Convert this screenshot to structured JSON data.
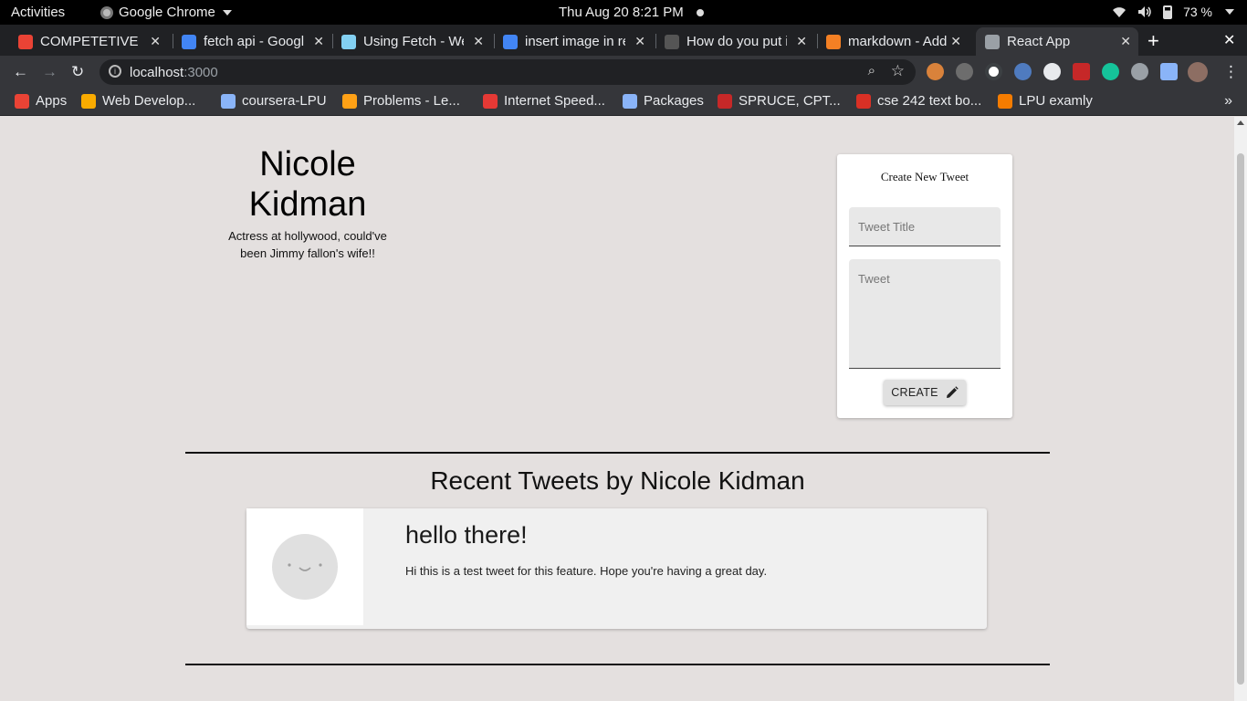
{
  "system_bar": {
    "activities": "Activities",
    "app_name": "Google Chrome",
    "datetime": "Thu Aug 20   8:21 PM",
    "battery": "73 %"
  },
  "tabs": [
    {
      "title": "COMPETETIVE E",
      "icon": "gmail-icon",
      "color": "#ea4335",
      "active": false
    },
    {
      "title": "fetch api - Googl",
      "icon": "google-icon",
      "color": "#4285f4",
      "active": false
    },
    {
      "title": "Using Fetch - We",
      "icon": "mdn-icon",
      "color": "#83d0f2",
      "active": false
    },
    {
      "title": "insert image in re",
      "icon": "google-icon",
      "color": "#4285f4",
      "active": false
    },
    {
      "title": "How do you put i",
      "icon": "github-icon",
      "color": "#555555",
      "active": false
    },
    {
      "title": "markdown - Add",
      "icon": "stackoverflow-icon",
      "color": "#f48024",
      "active": false
    },
    {
      "title": "React App",
      "icon": "globe-icon",
      "color": "#9aa0a6",
      "active": true
    }
  ],
  "omnibox": {
    "host": "localhost",
    "port": ":3000"
  },
  "bookmarks": [
    {
      "label": "Apps",
      "icon": "apps-grid-icon",
      "color": "#ea4335"
    },
    {
      "label": "Web Develop...",
      "icon": "bookmark-favicon-icon",
      "color": "#f9ab00"
    },
    {
      "label": "coursera-LPU",
      "icon": "coursera-icon",
      "color": "#8ab4f8"
    },
    {
      "label": "Problems - Le...",
      "icon": "leetcode-icon",
      "color": "#ffa116"
    },
    {
      "label": "Internet Speed...",
      "icon": "speedtest-icon",
      "color": "#e53935"
    },
    {
      "label": "Packages",
      "icon": "external-link-icon",
      "color": "#8ab4f8"
    },
    {
      "label": "SPRUCE, CPT...",
      "icon": "spruce-icon",
      "color": "#c62828"
    },
    {
      "label": "cse 242 text bo...",
      "icon": "pdf-icon",
      "color": "#d93025"
    },
    {
      "label": "LPU examly",
      "icon": "examly-icon",
      "color": "#f57c00"
    }
  ],
  "profile": {
    "name": "Nicole Kidman",
    "bio": "Actress at hollywood, could've been Jimmy fallon's wife!!"
  },
  "create_form": {
    "title": "Create New Tweet",
    "title_placeholder": "Tweet Title",
    "body_placeholder": "Tweet",
    "button_label": "CREATE"
  },
  "recent": {
    "heading": "Recent Tweets by Nicole Kidman",
    "tweets": [
      {
        "title": "hello there!",
        "body": "Hi this is a test tweet for this feature. Hope you're having a great day."
      }
    ]
  }
}
